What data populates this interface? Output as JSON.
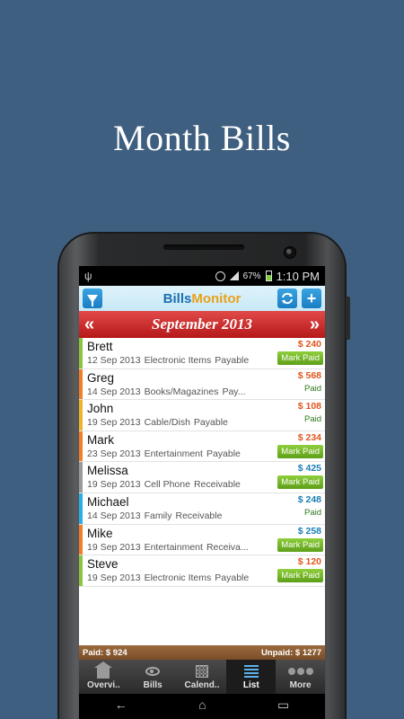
{
  "promo": {
    "title": "Month Bills"
  },
  "status_bar": {
    "usb_icon": "usb-icon",
    "battery_pct": "67%",
    "time": "1:10 PM"
  },
  "app": {
    "brand_part1": "Bills",
    "brand_part2": "Monitor",
    "filter_icon": "filter-icon",
    "sync_icon": "sync-icon",
    "add_label": "+"
  },
  "month_nav": {
    "prev": "«",
    "next": "»",
    "month": "September 2013"
  },
  "bills": [
    {
      "name": "Brett",
      "date": "12 Sep 2013",
      "category": "Electronic Items",
      "type": "Payable",
      "amount": "$ 240",
      "amount_color": "orange",
      "status": "Mark Paid",
      "status_style": "btn",
      "bar_color": "#8bc53f"
    },
    {
      "name": "Greg",
      "date": "14 Sep 2013",
      "category": "Books/Magazines",
      "type": "Pay...",
      "amount": "$ 568",
      "amount_color": "orange",
      "status": "Paid",
      "status_style": "text",
      "bar_color": "#f07f2a"
    },
    {
      "name": "John",
      "date": "19 Sep 2013",
      "category": "Cable/Dish",
      "type": "Payable",
      "amount": "$ 108",
      "amount_color": "orange",
      "status": "Paid",
      "status_style": "text",
      "bar_color": "#f0b42a"
    },
    {
      "name": "Mark",
      "date": "23 Sep 2013",
      "category": "Entertainment",
      "type": "Payable",
      "amount": "$ 234",
      "amount_color": "orange",
      "status": "Mark Paid",
      "status_style": "btn",
      "bar_color": "#f07f2a"
    },
    {
      "name": "Melissa",
      "date": "19 Sep 2013",
      "category": "Cell Phone",
      "type": "Receivable",
      "amount": "$ 425",
      "amount_color": "blue",
      "status": "Mark Paid",
      "status_style": "btn",
      "bar_color": "#9a9a9a"
    },
    {
      "name": "Michael",
      "date": "14 Sep 2013",
      "category": "Family",
      "type": "Receivable",
      "amount": "$ 248",
      "amount_color": "blue",
      "status": "Paid",
      "status_style": "text",
      "bar_color": "#2aaee8"
    },
    {
      "name": "Mike",
      "date": "19 Sep 2013",
      "category": "Entertainment",
      "type": "Receiva...",
      "amount": "$ 258",
      "amount_color": "blue",
      "status": "Mark Paid",
      "status_style": "btn",
      "bar_color": "#f07f2a"
    },
    {
      "name": "Steve",
      "date": "19 Sep 2013",
      "category": "Electronic Items",
      "type": "Payable",
      "amount": "$ 120",
      "amount_color": "orange",
      "status": "Mark Paid",
      "status_style": "btn",
      "bar_color": "#8bc53f"
    }
  ],
  "totals": {
    "paid": "Paid: $ 924",
    "unpaid": "Unpaid: $ 1277"
  },
  "tabs": [
    {
      "label": "Overvi..",
      "icon": "home-icon"
    },
    {
      "label": "Bills",
      "icon": "eye-icon"
    },
    {
      "label": "Calend..",
      "icon": "calendar-icon"
    },
    {
      "label": "List",
      "icon": "list-icon",
      "active": true
    },
    {
      "label": "More",
      "icon": "more-icon"
    }
  ],
  "nav": {
    "back": "←",
    "home": "⌂",
    "recent": "▭"
  }
}
